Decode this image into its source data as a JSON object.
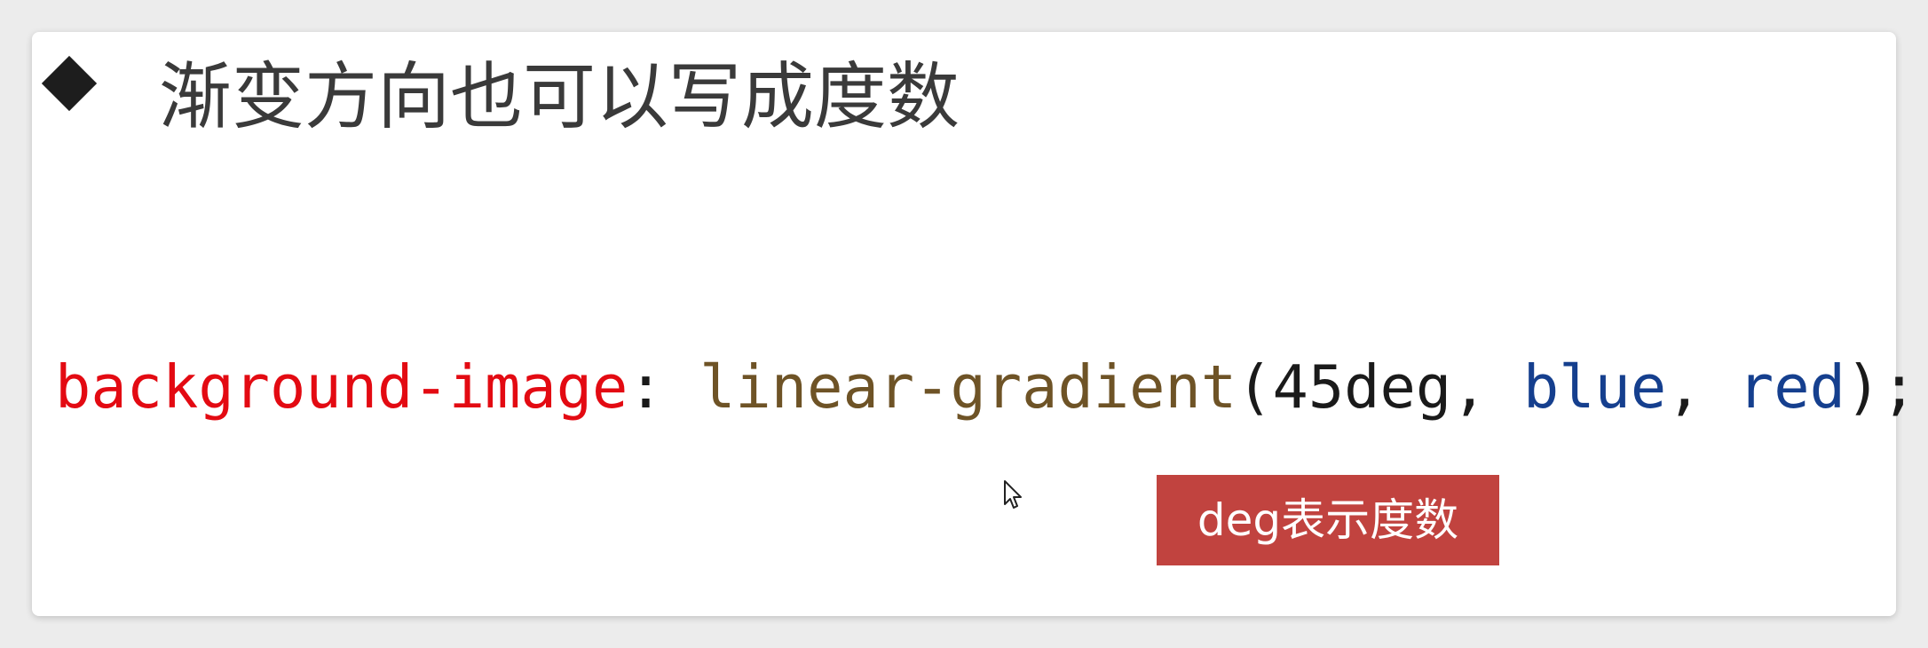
{
  "slide": {
    "title": "渐变方向也可以写成度数",
    "bullet_icon": "diamond-bullet-icon",
    "code": {
      "property": "background-image",
      "colon": ":",
      "function_name": "linear-gradient",
      "open_paren": "(",
      "angle": "45deg",
      "comma1": ",",
      "color1": "blue",
      "comma2": ",",
      "color2": "red",
      "close": ");"
    },
    "badge": "deg表示度数",
    "colors": {
      "property": "#e30a12",
      "function": "#6e5326",
      "value": "#153f8e",
      "badge_bg": "#c1433f"
    }
  }
}
